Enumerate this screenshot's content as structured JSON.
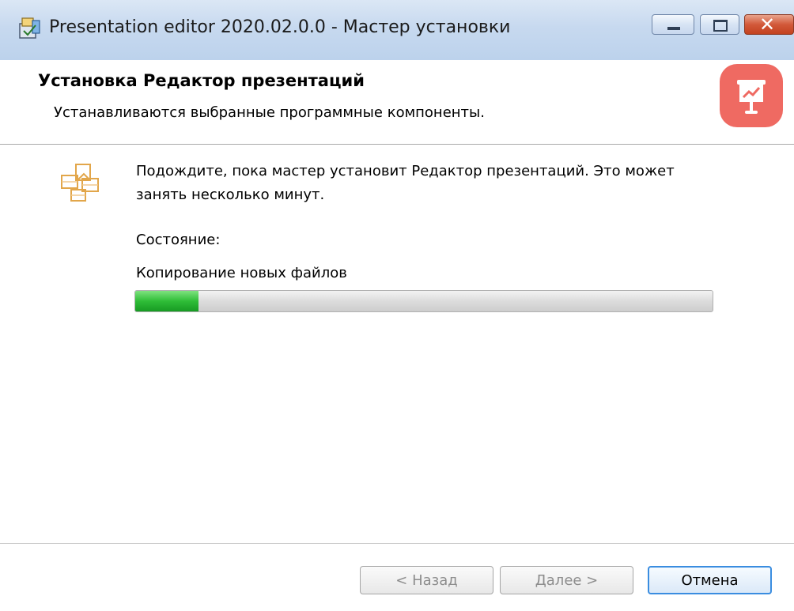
{
  "window": {
    "title": "Presentation editor 2020.02.0.0 - Мастер установки",
    "icons": {
      "app": "installer-icon",
      "minimize": "minimize-icon",
      "maximize": "maximize-icon",
      "close": "close-icon"
    }
  },
  "header": {
    "title": "Установка Редактор презентаций",
    "subtitle": "Устанавливаются выбранные программные компоненты.",
    "brand_icon": "presentation-logo-icon",
    "brand_color": "#ef6a62"
  },
  "content": {
    "icon": "setup-package-icon",
    "message": "Подождите, пока мастер установит Редактор презентаций. Это может занять несколько минут.",
    "status_label": "Состояние:",
    "status_text": "Копирование новых файлов",
    "progress_percent": 11,
    "progress_color": "#2fbd37"
  },
  "buttons": {
    "back": "< Назад",
    "next": "Далее >",
    "cancel": "Отмена"
  }
}
